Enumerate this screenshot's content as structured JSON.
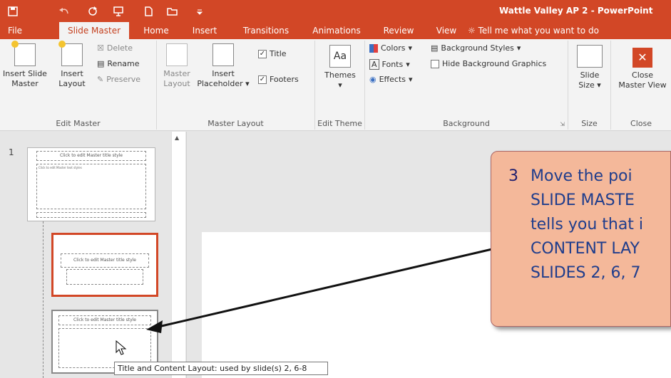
{
  "window": {
    "title": "Wattle Valley AP 2 - PowerPoint"
  },
  "tabs": [
    "File",
    "Slide Master",
    "Home",
    "Insert",
    "Transitions",
    "Animations",
    "Review",
    "View"
  ],
  "tell_me": "Tell me what you want to do",
  "ribbon": {
    "edit_master": {
      "label": "Edit Master",
      "insert_slide_master": [
        "Insert Slide",
        "Master"
      ],
      "insert_layout": [
        "Insert",
        "Layout"
      ],
      "delete": "Delete",
      "rename": "Rename",
      "preserve": "Preserve"
    },
    "master_layout": {
      "label": "Master Layout",
      "master_layout_btn": [
        "Master",
        "Layout"
      ],
      "insert_placeholder": [
        "Insert",
        "Placeholder"
      ],
      "title": "Title",
      "footers": "Footers"
    },
    "edit_theme": {
      "label": "Edit Theme",
      "themes": "Themes",
      "aa": "Aa"
    },
    "background": {
      "label": "Background",
      "colors": "Colors",
      "fonts": "Fonts",
      "effects": "Effects",
      "background_styles": "Background Styles",
      "hide_background": "Hide Background Graphics"
    },
    "size": {
      "label": "Size",
      "slide_size": [
        "Slide",
        "Size"
      ]
    },
    "close": {
      "label": "Close",
      "close_master": [
        "Close",
        "Master View"
      ]
    }
  },
  "thumbnails": {
    "slide_number": "1",
    "master_title": "Click to edit Master title style",
    "master_text": "Click to edit Master text styles"
  },
  "callout": {
    "number": "3",
    "lines": [
      "Move the poi",
      "SLIDE MASTE",
      "tells you that i",
      "CONTENT LAY",
      "SLIDES 2, 6, 7"
    ]
  },
  "tooltip": "Title and Content Layout: used by slide(s) 2, 6-8",
  "colors": {
    "accent": "#d24726",
    "callout_fill": "#f4b89a",
    "callout_text": "#1f3d8c"
  }
}
